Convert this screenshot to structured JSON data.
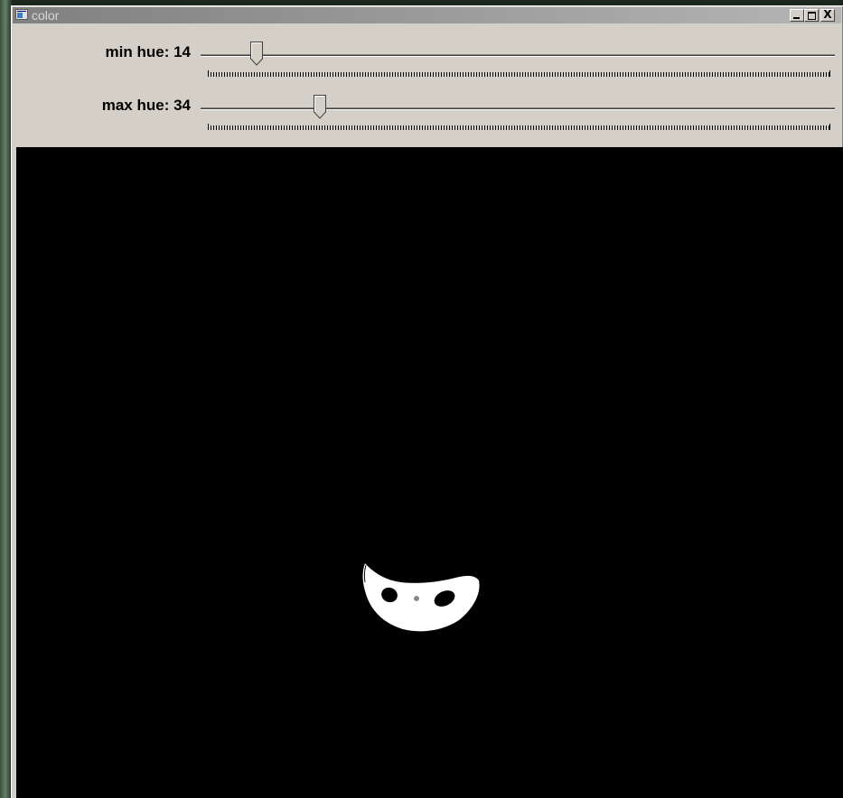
{
  "window": {
    "title": "color",
    "title_icon": "app-window-icon",
    "controls": [
      "minimize-icon",
      "maximize-icon",
      "close-icon"
    ],
    "close_glyph": "X"
  },
  "sliders": [
    {
      "label": "min hue: 14",
      "value": 14
    },
    {
      "label": "max hue: 34",
      "value": 34
    }
  ],
  "image": {
    "background": "#000000",
    "blob_color": "#ffffff"
  }
}
